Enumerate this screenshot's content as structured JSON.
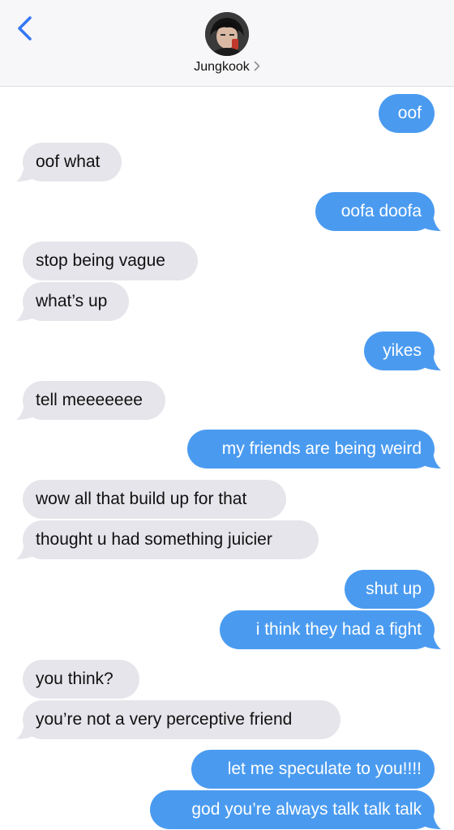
{
  "header": {
    "contact_name": "Jungkook",
    "back_icon": "chevron-left-icon",
    "chevron_icon": "chevron-right-icon",
    "accent_color": "#3478f6"
  },
  "colors": {
    "incoming_bubble": "#e6e5eb",
    "outgoing_bubble": "#4a9bf0"
  },
  "messages": [
    {
      "dir": "out",
      "text": "oof"
    },
    {
      "dir": "in",
      "text": "oof what"
    },
    {
      "dir": "out",
      "text": "oofa doofa"
    },
    {
      "dir": "in",
      "text": "stop being vague"
    },
    {
      "dir": "in",
      "text": "what’s up"
    },
    {
      "dir": "out",
      "text": "yikes"
    },
    {
      "dir": "in",
      "text": "tell meeeeeee"
    },
    {
      "dir": "out",
      "text": "my friends are being weird"
    },
    {
      "dir": "in",
      "text": "wow all that build up for that"
    },
    {
      "dir": "in",
      "text": "thought u had something juicier"
    },
    {
      "dir": "out",
      "text": "shut up"
    },
    {
      "dir": "out",
      "text": "i think they had a fight"
    },
    {
      "dir": "in",
      "text": "you think?"
    },
    {
      "dir": "in",
      "text": "you’re not a very perceptive friend"
    },
    {
      "dir": "out",
      "text": "let me speculate to you!!!!"
    },
    {
      "dir": "out",
      "text": "god you’re always talk talk talk"
    }
  ]
}
